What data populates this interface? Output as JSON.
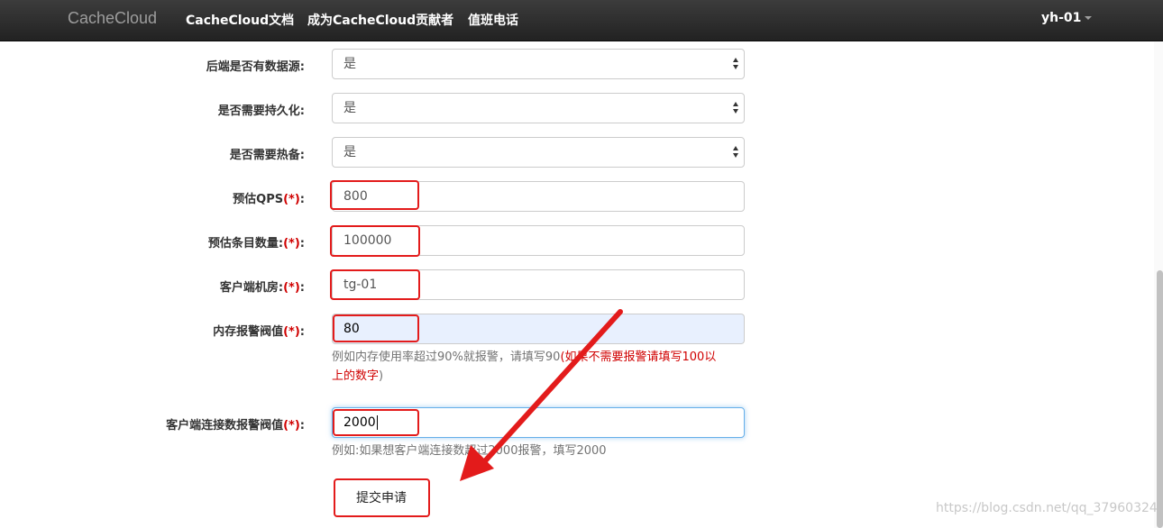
{
  "navbar": {
    "brand": "CacheCloud",
    "links": [
      "CacheCloud文档",
      "成为CacheCloud贡献者",
      "值班电话"
    ],
    "user": "yh-01"
  },
  "form": {
    "has_data_source": {
      "label": "后端是否有数据源:",
      "value": "是"
    },
    "need_persistence": {
      "label": "是否需要持久化:",
      "value": "是"
    },
    "need_hot_standby": {
      "label": "是否需要热备:",
      "value": "是"
    },
    "qps": {
      "label": "预估QPS",
      "required_mark": "(*)",
      "colon": ":",
      "value": "800"
    },
    "entry_count": {
      "label": "预估条目数量:",
      "required_mark": "(*)",
      "colon": ":",
      "value": "100000"
    },
    "client_room": {
      "label": "客户端机房:",
      "required_mark": "(*)",
      "colon": ":",
      "value": "tg-01"
    },
    "memory_alert": {
      "label": "内存报警阀值",
      "required_mark": "(*)",
      "colon": ":",
      "value": "80",
      "help_line1": "例如内存使用率超过90%就报警，请填写90",
      "help_red1": "(如果不需要报警请填写100以",
      "help_red2": "上的数字",
      "help_end": ")"
    },
    "client_conn_alert": {
      "label": "客户端连接数报警阀值",
      "required_mark": "(*)",
      "colon": ":",
      "value": "2000",
      "help": "例如:如果想客户端连接数超过2000报警，填写2000"
    },
    "submit_label": "提交申请"
  },
  "watermark": "https://blog.csdn.net/qq_37960324",
  "colors": {
    "annotation": "#e31b1b",
    "required": "#d00000",
    "navbar": "#222222"
  }
}
